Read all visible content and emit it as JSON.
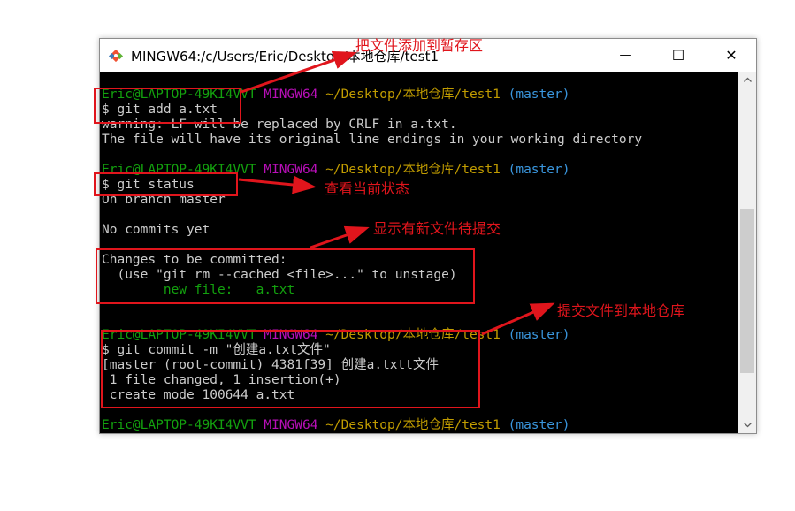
{
  "window": {
    "title": "MINGW64:/c/Users/Eric/Desktop/本地仓库/test1",
    "minimize_glyph": "—",
    "maximize_glyph": "☐",
    "close_glyph": "✕"
  },
  "prompt": {
    "user_host": "Eric@LAPTOP-49KI4VVT",
    "env": "MINGW64",
    "path": "~/Desktop/本地仓库/test1",
    "branch": "(master)"
  },
  "terminal": {
    "cmd_add": "$ git add a.txt",
    "warning_line": "warning: LF will be replaced by CRLF in a.txt.",
    "line_endings": "The file will have its original line endings in your working directory",
    "cmd_status": "$ git status",
    "on_branch": "On branch master",
    "no_commits": "No commits yet",
    "changes_header": "Changes to be committed:",
    "unstage_hint": "  (use \"git rm --cached <file>...\" to unstage)",
    "new_file": "        new file:   a.txt",
    "cmd_commit": "$ git commit -m \"创建a.txt文件\"",
    "commit_result": "[master (root-commit) 4381f39] 创建a.txtt文件",
    "files_changed": " 1 file changed, 1 insertion(+)",
    "create_mode": " create mode 100644 a.txt"
  },
  "annotations": {
    "add_to_staging": "把文件添加到暂存区",
    "view_status": "查看当前状态",
    "shows_new_file": "显示有新文件待提交",
    "commit_to_repo": "提交文件到本地仓库"
  },
  "colors": {
    "annotation_red": "#e0151c",
    "prompt_green": "#13a10e",
    "prompt_magenta": "#b80fb8",
    "prompt_yellow": "#c19c00",
    "prompt_cyan": "#3a96dd"
  }
}
